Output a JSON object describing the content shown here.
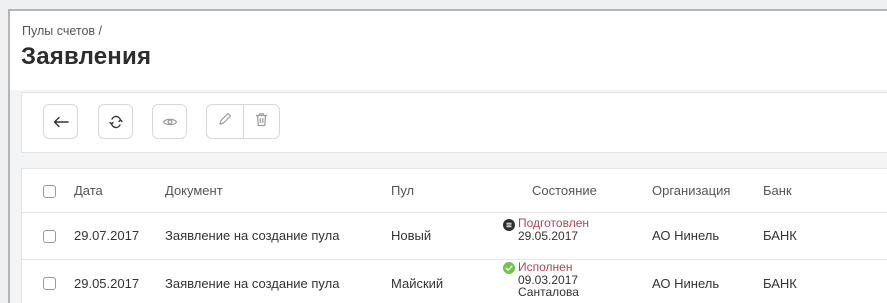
{
  "breadcrumb": "Пулы счетов /",
  "title": "Заявления",
  "toolbar": {
    "buttons": [
      {
        "icon": "arrow-left-icon"
      },
      {
        "icon": "refresh-icon"
      },
      {
        "icon": "eye-icon"
      },
      {
        "icon": "pencil-icon"
      },
      {
        "icon": "trash-icon"
      }
    ]
  },
  "table": {
    "columns": [
      "Дата",
      "Документ",
      "Пул",
      "Состояние",
      "Организация",
      "Банк"
    ],
    "rows": [
      {
        "date": "29.07.2017",
        "document": "Заявление на создание пула",
        "pool": "Новый",
        "state": {
          "icon": "prepared-icon",
          "status": "Подготовлен",
          "date": "29.05.2017",
          "person": ""
        },
        "organization": "АО Нинель",
        "bank": "БАНК"
      },
      {
        "date": "29.05.2017",
        "document": "Заявление на создание пула",
        "pool": "Майский",
        "state": {
          "icon": "check-icon",
          "status": "Исполнен",
          "date": "09.03.2017",
          "person": "Санталова"
        },
        "organization": "АО Нинель",
        "bank": "БАНК"
      }
    ]
  },
  "colors": {
    "status_text": "#b0445a",
    "prepared_icon": "#2f2f2f",
    "done_icon": "#6fc54a",
    "background": "#f3f4f5"
  }
}
